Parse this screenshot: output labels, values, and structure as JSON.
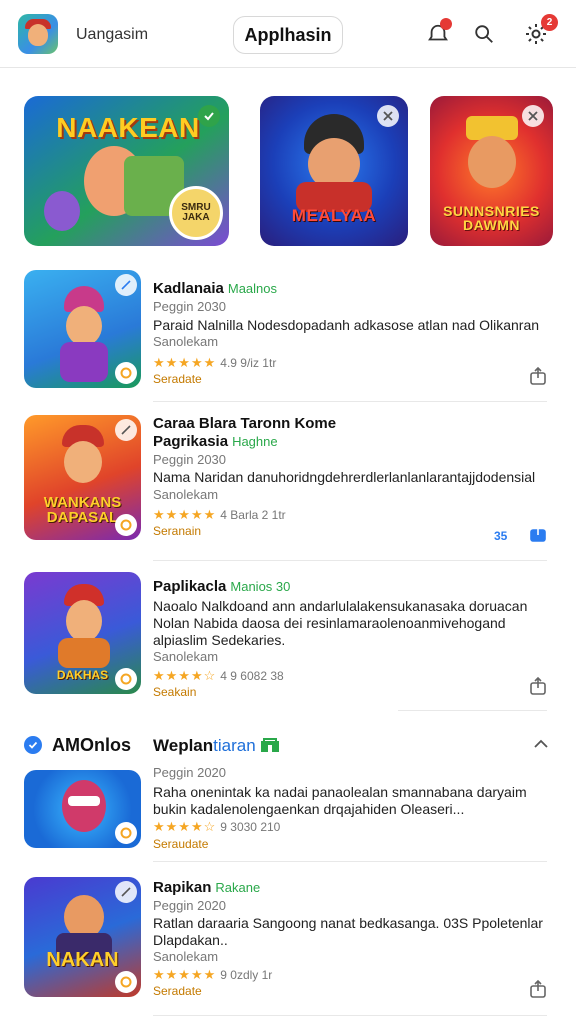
{
  "header": {
    "app_name": "Uangasim",
    "title": "Applhasin",
    "notification_badge": "",
    "settings_badge": "2"
  },
  "featured": [
    {
      "title": "NAAKEAN",
      "badge": "SMRU JAKA"
    },
    {
      "title": "MEALYAA"
    },
    {
      "title": "SUNNSNRIES DAWMN"
    }
  ],
  "items": [
    {
      "name": "Kadlanaia",
      "tag": "Maalnos",
      "sub": "Peggin 2030",
      "desc": "Paraid Nalnilla Nodesdopadanh adkasose atlan nad Olikanran",
      "desc2": "Sanolekam",
      "rating": "4.9 9/iz 1tr",
      "link": "Seradate",
      "thumb_text": ""
    },
    {
      "name": "Caraa Blara Taronn Kome",
      "name2": "Pagrikasia",
      "tag": "Haghne",
      "sub": "Peggin 2030",
      "desc": "Nama Naridan danuhoridngdehrerdlerlanlanlarantajjdodensial",
      "desc2": "Sanolekam",
      "rating": "4 Barla 2 1tr",
      "link": "Seranain",
      "count": "35",
      "thumb_text": "WANKANS DAPASAL"
    },
    {
      "name": "Paplikacla",
      "tag": "Manios 30",
      "desc": "Naoalo Nalkdoand ann andarlulalakensukanasaka doruacan Nolan Nabida daosa dei resinlamaraolenoanmivehogand alpiaslim Sedekaries.",
      "desc2": "Sanolekam",
      "rating": "4 9 6082 38",
      "link": "Seakain",
      "thumb_text": "DAKHAS"
    }
  ],
  "section": {
    "left_label": "AMOnlos",
    "title": "Weplan",
    "title_blue": "tiaran"
  },
  "section_items": [
    {
      "sub": "Peggin 2020",
      "desc": "Raha onenintak ka nadai panaolealan smannabana daryaim bukin kadalenolengaenkan drqajahiden Oleaseri...",
      "rating": "9 3030 210",
      "link": "Seraudate"
    },
    {
      "name": "Rapikan",
      "tag": "Rakane",
      "sub": "Peggin 2020",
      "desc": "Ratlan daraaria Sangoong nanat bedkasanga. 03S Ppoletenlar Dlapdakan..",
      "desc2": "Sanolekam",
      "rating": "9 0zdly 1r",
      "link": "Seradate",
      "thumb_text": "NAKAN"
    }
  ],
  "colors": {
    "accent": "#2b7cf0",
    "star": "#f5a623",
    "tag_green": "#2aa84a",
    "badge_red": "#e53935"
  }
}
